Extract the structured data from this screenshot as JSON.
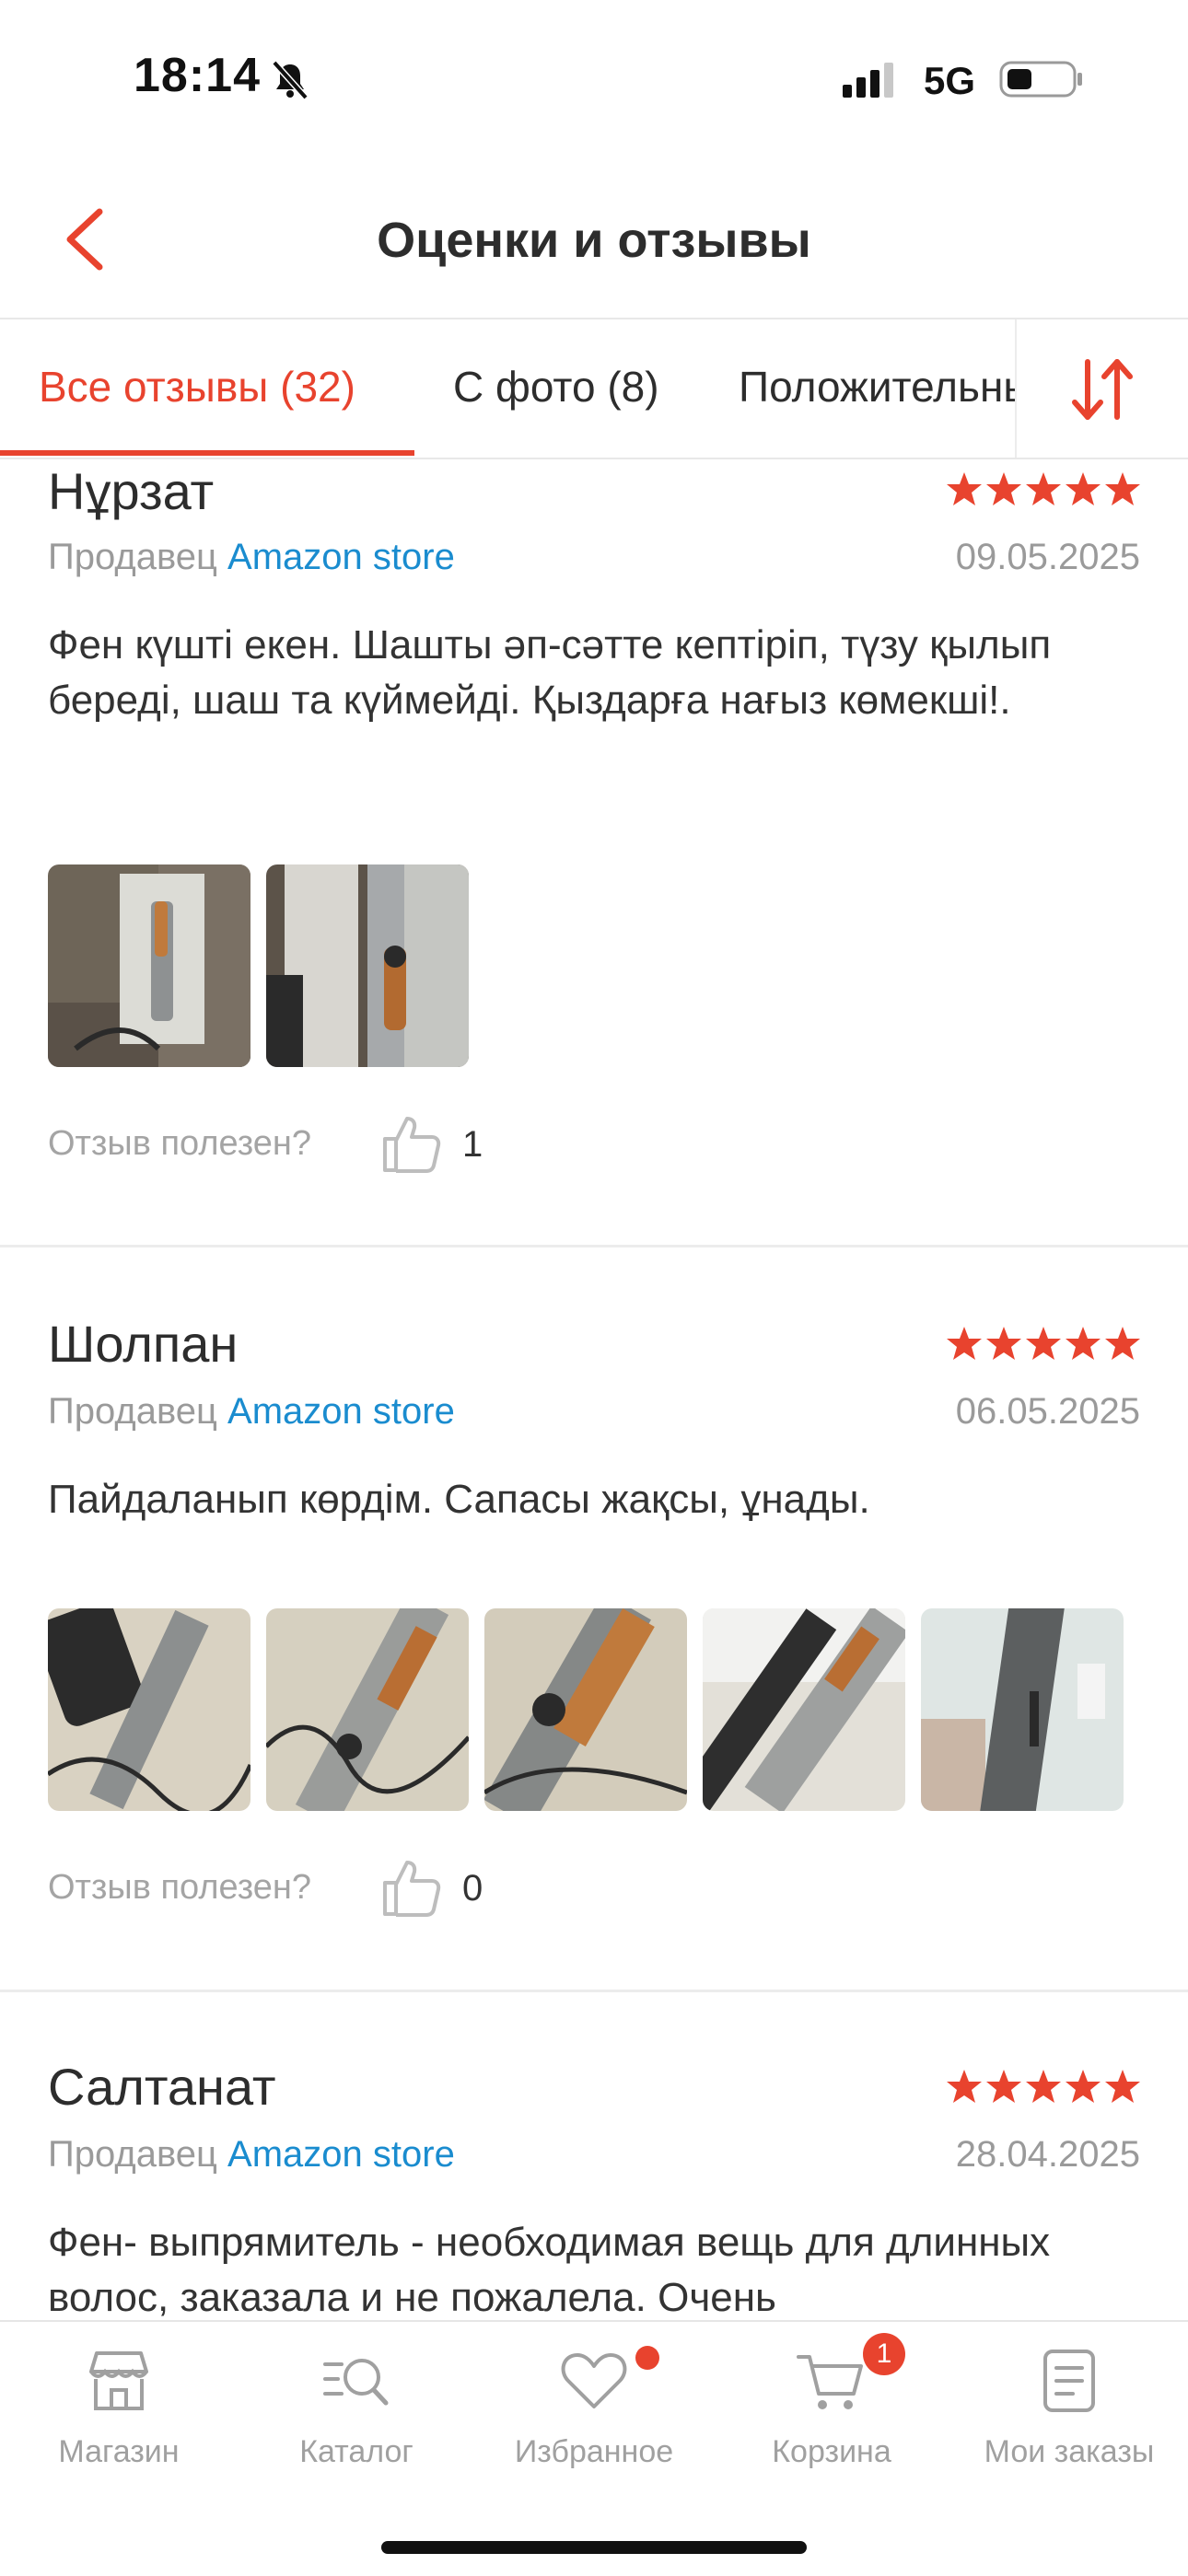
{
  "status_bar": {
    "time": "18:14",
    "network": "5G"
  },
  "header": {
    "title": "Оценки и отзывы"
  },
  "tabs": [
    {
      "label": "Все отзывы (32)",
      "active": true
    },
    {
      "label": "С фото (8)",
      "active": false
    },
    {
      "label": "Положительные",
      "active": false
    }
  ],
  "colors": {
    "accent": "#e8432e",
    "link": "#1a8ccf",
    "muted": "#9a9a9a"
  },
  "reviews": [
    {
      "name": "Нұрзат",
      "rating": 5,
      "seller_prefix": "Продавец",
      "seller_name": "Amazon store",
      "date": "09.05.2025",
      "text": "Фен күшті екен. Шашты әп-сәтте кептіріп, түзу қылып береді, шаш та күймейді. Қыздарға нағыз көмекші!.",
      "photo_count": 2,
      "helpful_label": "Отзыв полезен?",
      "helpful_count": "1"
    },
    {
      "name": "Шолпан",
      "rating": 5,
      "seller_prefix": "Продавец",
      "seller_name": "Amazon store",
      "date": "06.05.2025",
      "text": "Пайдаланып көрдім. Сапасы жақсы, ұнады.",
      "photo_count": 5,
      "helpful_label": "Отзыв полезен?",
      "helpful_count": "0"
    },
    {
      "name": "Салтанат",
      "rating": 5,
      "seller_prefix": "Продавец",
      "seller_name": "Amazon store",
      "date": "28.04.2025",
      "text": "Фен- выпрямитель - необходимая вещь для длинных волос, заказала и не пожалела. Очень"
    }
  ],
  "bottom_nav": [
    {
      "label": "Магазин",
      "icon": "store-icon"
    },
    {
      "label": "Каталог",
      "icon": "catalog-search-icon"
    },
    {
      "label": "Избранное",
      "icon": "heart-icon",
      "badge_dot": true
    },
    {
      "label": "Корзина",
      "icon": "cart-icon",
      "badge": "1"
    },
    {
      "label": "Мои заказы",
      "icon": "orders-icon"
    }
  ]
}
